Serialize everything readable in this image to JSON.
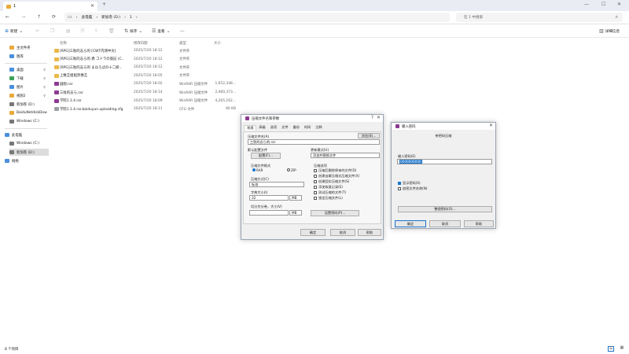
{
  "explorer": {
    "tab_title": "1",
    "nav": {
      "back": "←",
      "forward": "→",
      "up": "↑",
      "refresh": "⟳"
    },
    "breadcrumb": [
      "此电脑",
      "新加卷 (D:)",
      "1"
    ],
    "search_placeholder": "在 1 中搜索",
    "commands": {
      "new": "新建",
      "sort": "排序",
      "view": "查看",
      "more": "···",
      "details": "详细信息"
    },
    "columns": {
      "name": "名称",
      "date": "修改日期",
      "type": "类型",
      "size": "大小"
    },
    "files": [
      {
        "name": "[RPG]三败的志ら的 [CWT内测中文]",
        "date": "2025/7/20 18:12",
        "type": "文件夹",
        "size": "",
        "icon": "folder"
      },
      {
        "name": "[RPG]三败的志ら的 異 コドラの旅記 (C..",
        "date": "2025/7/20 18:12",
        "type": "文件夹",
        "size": "",
        "icon": "folder"
      },
      {
        "name": "[RPG]三败的志ら的 まほろばの十二姉...",
        "date": "2025/7/20 18:12",
        "type": "文件夹",
        "size": "",
        "icon": "folder"
      },
      {
        "name": "上数王姐姐热像王",
        "date": "2025/7/20 18:05",
        "type": "文件夹",
        "size": "",
        "icon": "folder"
      },
      {
        "name": "副图.rar",
        "date": "2025/7/20 18:02",
        "type": "WinRAR 压缩文件",
        "size": "1,652,348...",
        "icon": "rar"
      },
      {
        "name": "三败的志ら.rar",
        "date": "2025/7/20 18:14",
        "type": "WinRAR 压缩文件",
        "size": "2,460,373...",
        "icon": "rar"
      },
      {
        "name": "学院1.1.4.rar",
        "date": "2025/7/20 18:09",
        "type": "WinRAR 压缩文件",
        "size": "4,265,162...",
        "icon": "rar"
      },
      {
        "name": "学院1.1.4.rar.baiduyun.uploading.cfg",
        "date": "2025/7/20 18:11",
        "type": "CFG 文件",
        "size": "80 KB",
        "icon": "cfg"
      }
    ],
    "sidebar_quick": [
      {
        "label": "主文件夹",
        "color": "#e9a93b"
      },
      {
        "label": "图库",
        "color": "#4a8fdc"
      }
    ],
    "sidebar_pinned": [
      {
        "label": "桌面",
        "color": "#4a8fdc"
      },
      {
        "label": "下载",
        "color": "#3aa35a"
      },
      {
        "label": "图片",
        "color": "#4a8fdc"
      },
      {
        "label": "视频2",
        "color": "#e9a93b"
      },
      {
        "label": "新加卷 (D:)",
        "color": "#777777"
      },
      {
        "label": "BaiduNetdiskDow",
        "color": "#e9a93b"
      },
      {
        "label": "Windows (C:)",
        "color": "#777777"
      }
    ],
    "sidebar_tree": [
      {
        "label": "此电脑",
        "color": "#4a8fdc"
      },
      {
        "label": "Windows (C:)",
        "color": "#777777"
      },
      {
        "label": "新加卷 (D:)",
        "color": "#777777"
      },
      {
        "label": "网络",
        "color": "#4a8fdc"
      }
    ],
    "status": "8 个项目"
  },
  "rar_dialog": {
    "title": "压缩文件名和参数",
    "tabs": [
      "常规",
      "高级",
      "选项",
      "文件",
      "备份",
      "时间",
      "注释"
    ],
    "archive_name_label": "压缩文件名(A)",
    "browse": "浏览(B)...",
    "archive_name": "三败的志ら的.rar",
    "profile_label": "默认配置文件",
    "profile_button": "配置(F)...",
    "update_label": "更新模式(U)",
    "update_value": "添加并替换文件",
    "format_label": "压缩文件格式",
    "format_rar": "RAR",
    "format_zip": "ZIP",
    "method_label": "压缩方式(C)",
    "method_value": "标准",
    "dict_label": "字典大小(I)",
    "dict_value": "32",
    "dict_unit": "MB",
    "split_label": "切分为分卷，大小(V)",
    "split_unit": "MB",
    "options_label": "压缩选项",
    "options": [
      "压缩后删除原来的文件(D)",
      "创建自解压格式压缩文件(X)",
      "创建固实压缩文件(S)",
      "添加恢复记录(E)",
      "测试压缩的文件(T)",
      "锁定压缩文件(L)"
    ],
    "password_button": "设置密码(P)...",
    "ok": "确定",
    "cancel": "取消",
    "help": "帮助"
  },
  "pwd_dialog": {
    "title": "输入密码",
    "line1": "带密码压缩",
    "line2": "",
    "field_label": "输入密码(E)",
    "field_value": "0000000000",
    "show_password": "显示密码(S)",
    "encrypt_names": "加密文件名称(N)",
    "manage": "整理密码(O)...",
    "ok": "确定",
    "cancel": "取消",
    "help": "帮助"
  }
}
